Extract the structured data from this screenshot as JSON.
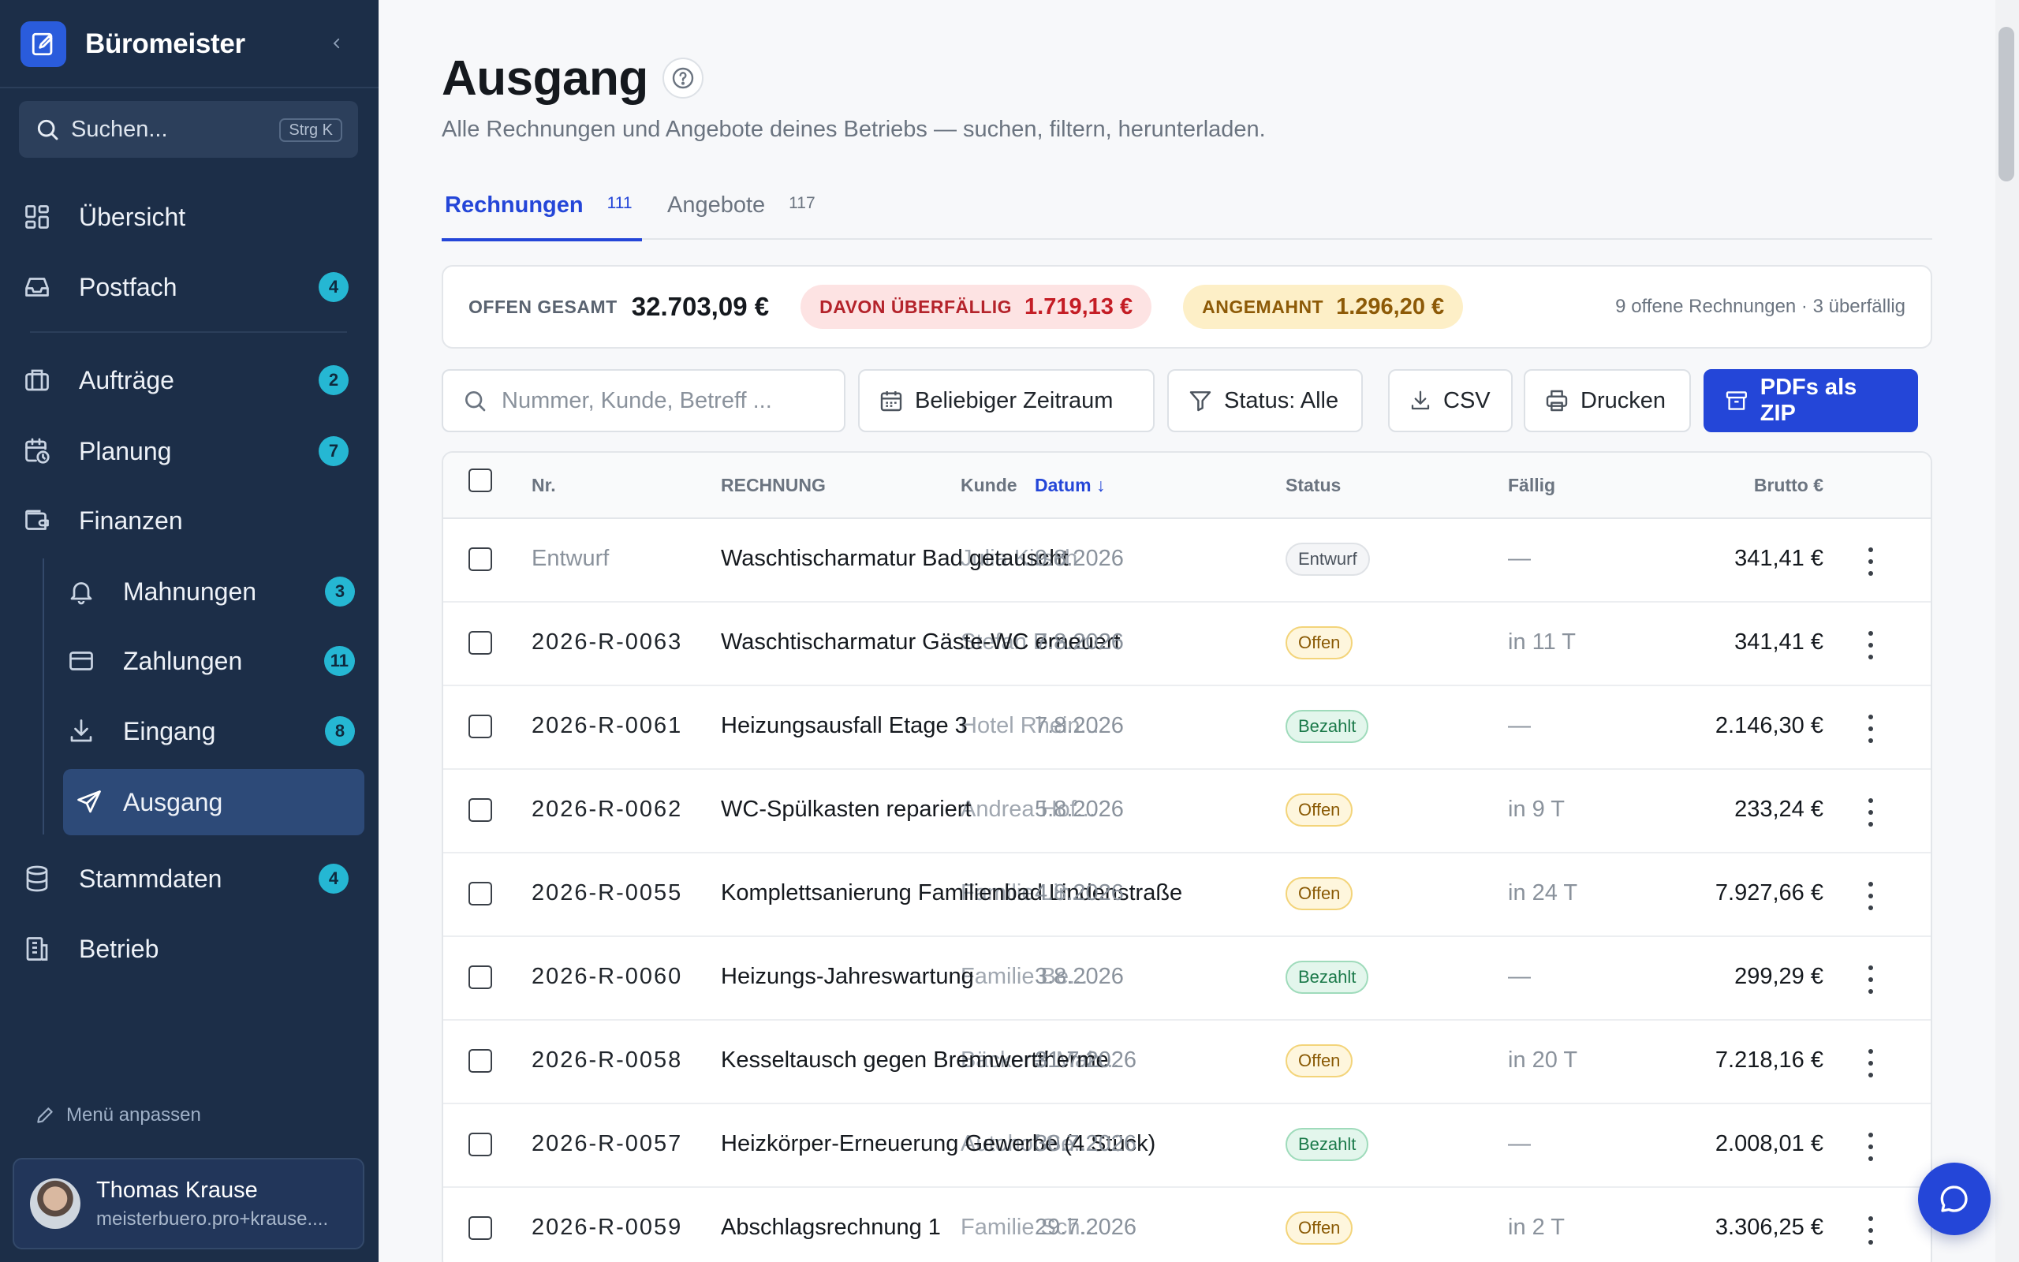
{
  "app": {
    "name": "Büromeister"
  },
  "sidebar": {
    "search": {
      "label": "Suchen...",
      "shortcut": "Strg K"
    },
    "items": [
      {
        "label": "Übersicht",
        "icon": "dashboard-icon"
      },
      {
        "label": "Postfach",
        "icon": "inbox-icon",
        "badge": "4"
      },
      {
        "label": "Aufträge",
        "icon": "briefcase-icon",
        "badge": "2"
      },
      {
        "label": "Planung",
        "icon": "calendar-clock-icon",
        "badge": "7"
      },
      {
        "label": "Finanzen",
        "icon": "wallet-icon"
      },
      {
        "label": "Mahnungen",
        "icon": "bell-icon",
        "badge": "3"
      },
      {
        "label": "Zahlungen",
        "icon": "credit-card-icon",
        "badge": "11"
      },
      {
        "label": "Eingang",
        "icon": "download-icon",
        "badge": "8"
      },
      {
        "label": "Ausgang",
        "icon": "send-icon",
        "active": true
      },
      {
        "label": "Stammdaten",
        "icon": "database-icon",
        "badge": "4"
      },
      {
        "label": "Betrieb",
        "icon": "building-icon"
      }
    ],
    "customize_label": "Menü anpassen",
    "user": {
      "name": "Thomas Krause",
      "email": "meisterbuero.pro+krause...."
    }
  },
  "page": {
    "title": "Ausgang",
    "subtitle": "Alle Rechnungen und Angebote deines Betriebs — suchen, filtern, herunterladen.",
    "tabs": [
      {
        "label": "Rechnungen",
        "count": "111",
        "active": true
      },
      {
        "label": "Angebote",
        "count": "117"
      }
    ]
  },
  "summary": {
    "open_label": "OFFEN GESAMT",
    "open_value": "32.703,09 €",
    "overdue_label": "DAVON ÜBERFÄLLIG",
    "overdue_value": "1.719,13 €",
    "dunned_label": "ANGEMAHNT",
    "dunned_value": "1.296,20 €",
    "note": "9 offene Rechnungen · 3 überfällig"
  },
  "toolbar": {
    "search_placeholder": "Nummer, Kunde, Betreff ...",
    "period_label": "Beliebiger Zeitraum",
    "status_label": "Status: Alle",
    "csv_label": "CSV",
    "print_label": "Drucken",
    "zip_label": "PDFs als ZIP"
  },
  "table": {
    "columns": {
      "nr": "Nr.",
      "invoice": "RECHNUNG",
      "customer": "Kunde",
      "date": "Datum ↓",
      "status": "Status",
      "due": "Fällig",
      "gross": "Brutto €"
    },
    "rows": [
      {
        "nr": "Entwurf",
        "customer": "Julia Kirsch",
        "title": "Waschtischarmatur Bad getauscht",
        "date": "9.8.2026",
        "status": "Entwurf",
        "status_kind": "draft",
        "due": "—",
        "amount": "341,41 €"
      },
      {
        "nr": "2026-R-0063",
        "customer": "Stefan Braun",
        "title": "Waschtischarmatur Gäste-WC erneuert",
        "date": "7.8.2026",
        "status": "Offen",
        "status_kind": "open",
        "due": "in 11 T",
        "amount": "341,41 €"
      },
      {
        "nr": "2026-R-0061",
        "customer": "Hotel Rhein...",
        "title": "Heizungsausfall Etage 3",
        "date": "7.8.2026",
        "status": "Bezahlt",
        "status_kind": "paid",
        "due": "—",
        "amount": "2.146,30 €"
      },
      {
        "nr": "2026-R-0062",
        "customer": "Andrea Hof...",
        "title": "WC-Spülkasten repariert",
        "date": "5.8.2026",
        "status": "Offen",
        "status_kind": "open",
        "due": "in 9 T",
        "amount": "233,24 €"
      },
      {
        "nr": "2026-R-0055",
        "customer": "Familie Lin...",
        "title": "Komplettsanierung Familienbad Lindenstraße",
        "date": "4.8.2026",
        "status": "Offen",
        "status_kind": "open",
        "due": "in 24 T",
        "amount": "7.927,66 €"
      },
      {
        "nr": "2026-R-0060",
        "customer": "Familie Be...",
        "title": "Heizungs-Jahreswartung",
        "date": "3.8.2026",
        "status": "Bezahlt",
        "status_kind": "paid",
        "due": "—",
        "amount": "299,29 €"
      },
      {
        "nr": "2026-R-0058",
        "customer": "Bäckerei Mah...",
        "title": "Kesseltausch gegen Brennwerttherme",
        "date": "31.7.2026",
        "status": "Offen",
        "status_kind": "open",
        "due": "in 20 T",
        "amount": "7.218,16 €"
      },
      {
        "nr": "2026-R-0057",
        "customer": "Autohof Se...",
        "title": "Heizkörper-Erneuerung Gewerbe (4 Stück)",
        "date": "30.7.2026",
        "status": "Bezahlt",
        "status_kind": "paid",
        "due": "—",
        "amount": "2.008,01 €"
      },
      {
        "nr": "2026-R-0059",
        "customer": "Familie Sch...",
        "title": "Abschlagsrechnung 1",
        "date": "29.7.2026",
        "status": "Offen",
        "status_kind": "open",
        "due": "in 2 T",
        "amount": "3.306,25 €"
      }
    ]
  },
  "colors": {
    "sidebar": "#1c2e48",
    "accent": "#2446d8",
    "badge": "#25b7d3"
  }
}
